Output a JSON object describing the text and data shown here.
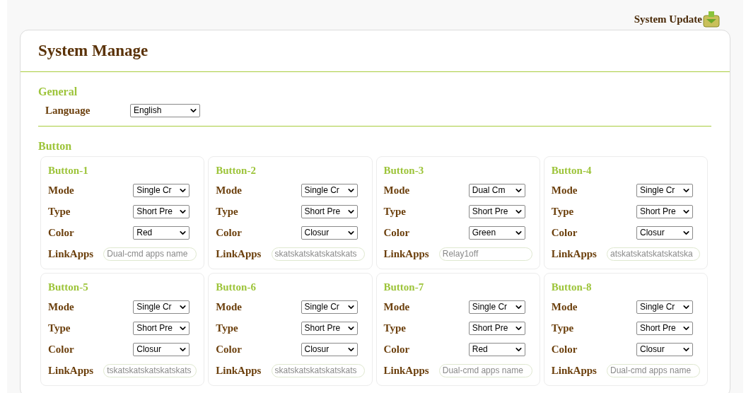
{
  "top_link": {
    "label": "System Update"
  },
  "title": "System Manage",
  "general": {
    "heading": "General",
    "language": {
      "label": "Language",
      "value": "English"
    }
  },
  "button_section": {
    "heading": "Button",
    "buttons": [
      {
        "title": "Button-1",
        "mode": {
          "label": "Mode",
          "value": "Single Cr"
        },
        "type": {
          "label": "Type",
          "value": "Short Pre"
        },
        "color": {
          "label": "Color",
          "value": "Red"
        },
        "link_apps": {
          "label": "LinkApps",
          "placeholder": "Dual-cmd apps name"
        }
      },
      {
        "title": "Button-2",
        "mode": {
          "label": "Mode",
          "value": "Single Cr"
        },
        "type": {
          "label": "Type",
          "value": "Short Pre"
        },
        "color": {
          "label": "Color",
          "value": "Closur"
        },
        "link_apps": {
          "label": "LinkApps",
          "value": "skatskatskatskatskats"
        }
      },
      {
        "title": "Button-3",
        "mode": {
          "label": "Mode",
          "value": "Dual Cm"
        },
        "type": {
          "label": "Type",
          "value": "Short Pre"
        },
        "color": {
          "label": "Color",
          "value": "Green"
        },
        "link_apps": {
          "label": "LinkApps",
          "value": "Relay1off"
        }
      },
      {
        "title": "Button-4",
        "mode": {
          "label": "Mode",
          "value": "Single Cr"
        },
        "type": {
          "label": "Type",
          "value": "Short Pre"
        },
        "color": {
          "label": "Color",
          "value": "Closur"
        },
        "link_apps": {
          "label": "LinkApps",
          "value": "atskatskatskatskatska"
        }
      },
      {
        "title": "Button-5",
        "mode": {
          "label": "Mode",
          "value": "Single Cr"
        },
        "type": {
          "label": "Type",
          "value": "Short Pre"
        },
        "color": {
          "label": "Color",
          "value": "Closur"
        },
        "link_apps": {
          "label": "LinkApps",
          "value": "tskatskatskatskatskats"
        }
      },
      {
        "title": "Button-6",
        "mode": {
          "label": "Mode",
          "value": "Single Cr"
        },
        "type": {
          "label": "Type",
          "value": "Short Pre"
        },
        "color": {
          "label": "Color",
          "value": "Closur"
        },
        "link_apps": {
          "label": "LinkApps",
          "value": "skatskatskatskatskats"
        }
      },
      {
        "title": "Button-7",
        "mode": {
          "label": "Mode",
          "value": "Single Cr"
        },
        "type": {
          "label": "Type",
          "value": "Short Pre"
        },
        "color": {
          "label": "Color",
          "value": "Red"
        },
        "link_apps": {
          "label": "LinkApps",
          "placeholder": "Dual-cmd apps name"
        }
      },
      {
        "title": "Button-8",
        "mode": {
          "label": "Mode",
          "value": "Single Cr"
        },
        "type": {
          "label": "Type",
          "value": "Short Pre"
        },
        "color": {
          "label": "Color",
          "value": "Closur"
        },
        "link_apps": {
          "label": "LinkApps",
          "placeholder": "Dual-cmd apps name"
        }
      }
    ]
  }
}
